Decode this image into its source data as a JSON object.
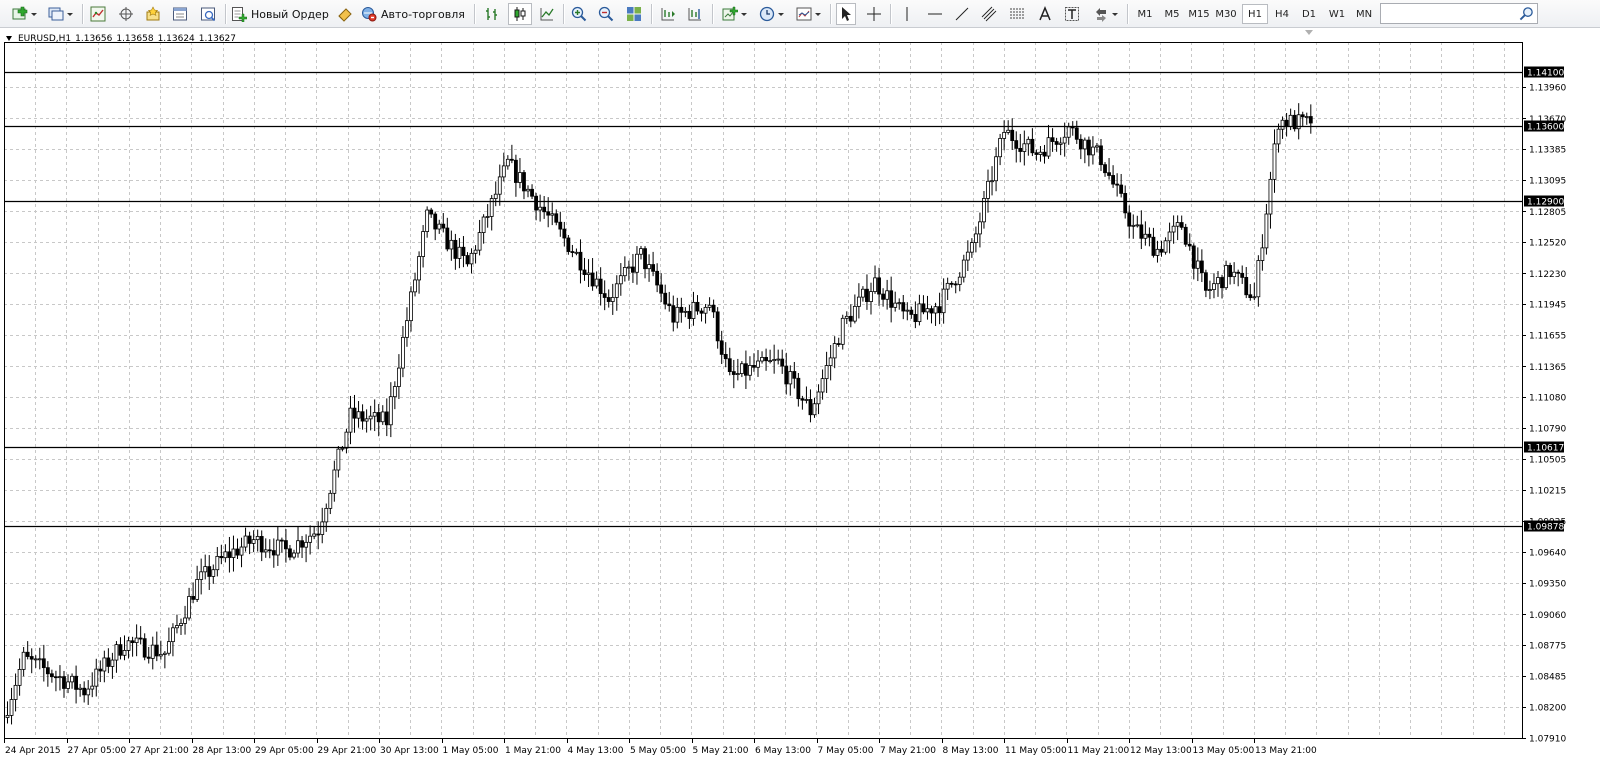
{
  "toolbar": {
    "buttons": [
      {
        "name": "new-chart-button",
        "icon": "new-chart-icon"
      },
      {
        "name": "profiles-button",
        "icon": "profiles-icon"
      },
      {
        "name": "market-watch-button",
        "icon": "market-watch-icon"
      },
      {
        "name": "data-window-button",
        "icon": "crosshair-icon"
      },
      {
        "name": "navigator-button",
        "icon": "navigator-stars-icon"
      },
      {
        "name": "terminal-button",
        "icon": "terminal-icon"
      },
      {
        "name": "strategy-tester-button",
        "icon": "tester-icon"
      }
    ],
    "new_order_label": "Новый Ордер",
    "auto_trading_label": "Авто-торговля",
    "timeframes": [
      "M1",
      "M5",
      "M15",
      "M30",
      "H1",
      "H4",
      "D1",
      "W1",
      "MN"
    ],
    "active_timeframe": "H1",
    "search_placeholder": ""
  },
  "chart_header": {
    "symbol": "EURUSD,H1",
    "open": "1.13656",
    "high": "1.13658",
    "low": "1.13624",
    "close": "1.13627"
  },
  "chart_data": {
    "type": "candlestick",
    "title": "EURUSD,H1",
    "price_ticks": [
      "1.13960",
      "1.13670",
      "1.13385",
      "1.13095",
      "1.12805",
      "1.12520",
      "1.12230",
      "1.11945",
      "1.11655",
      "1.11365",
      "1.11080",
      "1.10790",
      "1.10505",
      "1.10215",
      "1.09925",
      "1.09640",
      "1.09350",
      "1.09060",
      "1.08775",
      "1.08485",
      "1.08200",
      "1.07910"
    ],
    "ylim": [
      1.0791,
      1.1438
    ],
    "horizontal_levels": [
      "1.14100",
      "1.13600",
      "1.12900",
      "1.10617",
      "1.09878"
    ],
    "time_ticks": [
      "24 Apr 2015",
      "27 Apr 05:00",
      "27 Apr 21:00",
      "28 Apr 13:00",
      "29 Apr 05:00",
      "29 Apr 21:00",
      "30 Apr 13:00",
      "1 May 05:00",
      "1 May 21:00",
      "4 May 13:00",
      "5 May 05:00",
      "5 May 21:00",
      "6 May 13:00",
      "7 May 05:00",
      "7 May 21:00",
      "8 May 13:00",
      "11 May 05:00",
      "11 May 21:00",
      "12 May 13:00",
      "13 May 05:00",
      "13 May 21:00"
    ],
    "last_close": 1.13627,
    "bar_count": 324,
    "path_x": [
      0,
      5,
      10,
      20,
      30,
      40,
      48,
      55,
      62,
      70,
      78,
      86,
      95,
      105,
      115,
      125,
      140,
      150,
      158,
      166,
      175,
      180,
      186,
      192,
      200,
      208,
      216,
      224,
      232,
      240,
      248,
      256,
      264,
      272,
      280,
      286,
      292,
      298,
      304,
      310,
      316,
      323
    ],
    "path_y": [
      1.081,
      1.0865,
      1.0855,
      1.0835,
      1.088,
      1.087,
      1.0935,
      1.096,
      1.0975,
      1.0965,
      1.0985,
      1.109,
      1.1085,
      1.1275,
      1.123,
      1.1325,
      1.125,
      1.12,
      1.124,
      1.1182,
      1.1195,
      1.1125,
      1.1135,
      1.114,
      1.1095,
      1.1175,
      1.1215,
      1.118,
      1.1195,
      1.1245,
      1.1355,
      1.1335,
      1.1358,
      1.133,
      1.1265,
      1.1245,
      1.1268,
      1.1205,
      1.1225,
      1.12,
      1.1365,
      1.1362
    ]
  }
}
